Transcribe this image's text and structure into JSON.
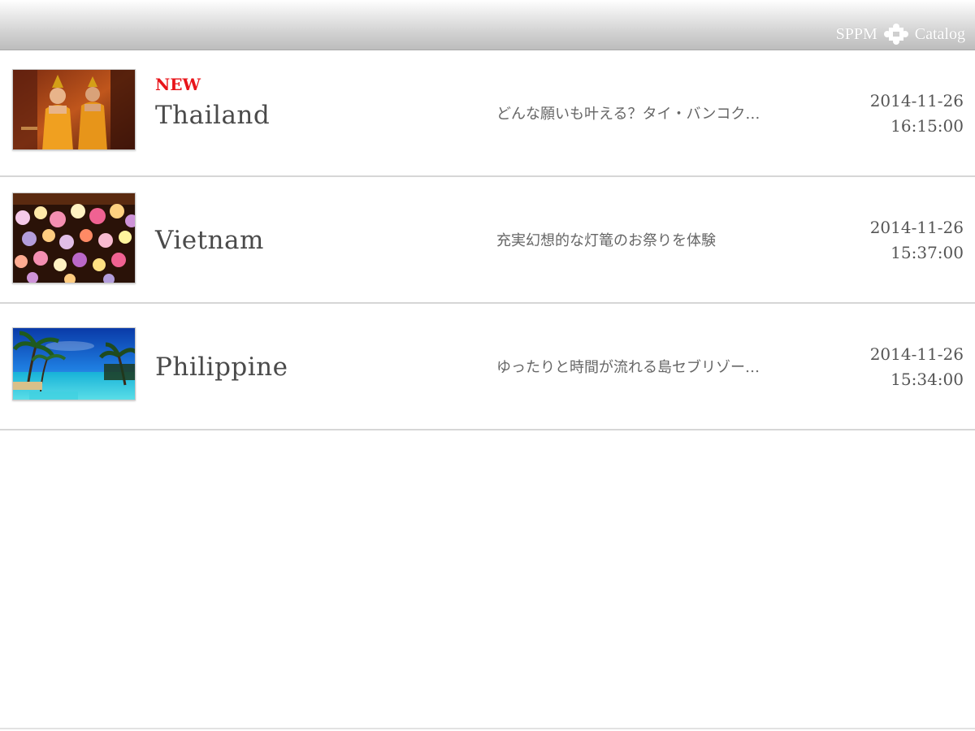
{
  "header": {
    "brand_left": "SPPM",
    "brand_right": "Catalog",
    "logo_icon": "puzzle-piece-icon"
  },
  "items": [
    {
      "badge": "NEW",
      "title": "Thailand",
      "description": "どんな願いも叶える？タイ・バンコク…",
      "date": "2014-11-26",
      "time": "16:15:00",
      "thumbnail": "thai-dancers-photo"
    },
    {
      "badge": "",
      "title": "Vietnam",
      "description": "充実幻想的な灯篭のお祭りを体験",
      "date": "2014-11-26",
      "time": "15:37:00",
      "thumbnail": "lanterns-photo"
    },
    {
      "badge": "",
      "title": "Philippine",
      "description": "ゆったりと時間が流れる島セブリゾー…",
      "date": "2014-11-26",
      "time": "15:34:00",
      "thumbnail": "tropical-beach-photo"
    }
  ],
  "colors": {
    "badge": "#e8141a",
    "divider": "#d6d6d6"
  }
}
